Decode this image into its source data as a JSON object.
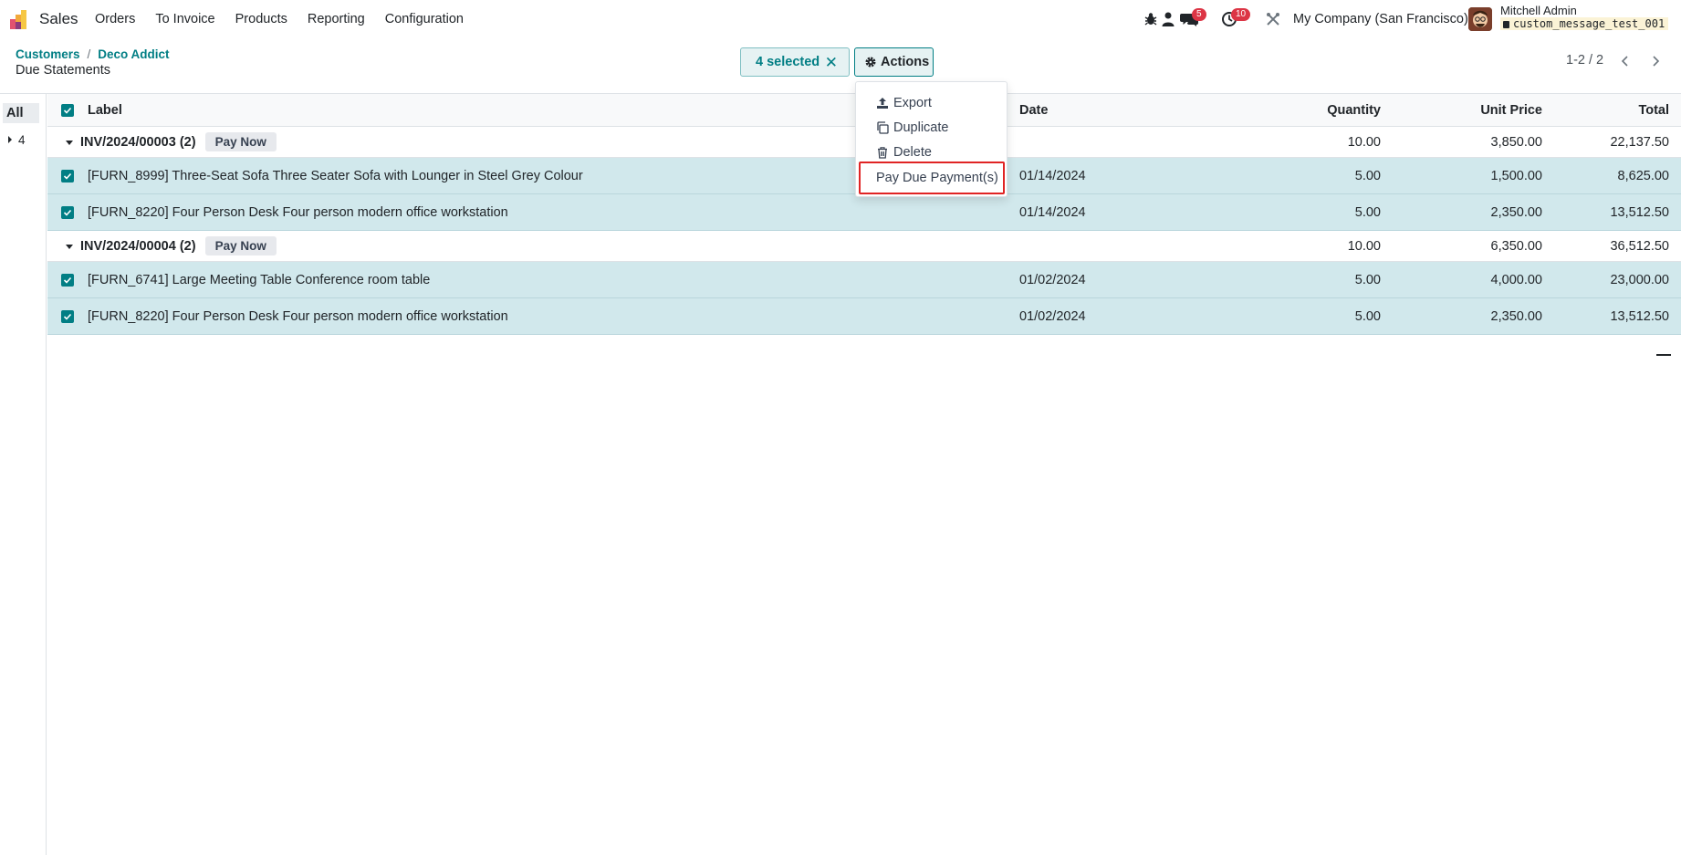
{
  "navbar": {
    "app_name": "Sales",
    "menu": [
      "Orders",
      "To Invoice",
      "Products",
      "Reporting",
      "Configuration"
    ],
    "messages_count": "5",
    "activities_count": "10",
    "company": "My Company (San Francisco)",
    "user_name": "Mitchell Admin",
    "database": "custom_message_test_001"
  },
  "control_panel": {
    "breadcrumb": [
      "Customers",
      "Deco Addict"
    ],
    "title": "Due Statements",
    "selected_label": "4 selected",
    "actions_label": "Actions",
    "pager": "1-2 / 2"
  },
  "actions_menu": {
    "items": [
      "Export",
      "Duplicate",
      "Delete"
    ],
    "highlighted_item": "Pay Due Payment(s)"
  },
  "left_panel": {
    "all_label": "All",
    "count": "4"
  },
  "table": {
    "columns": {
      "label": "Label",
      "date": "Date",
      "quantity": "Quantity",
      "unit_price": "Unit Price",
      "total": "Total"
    },
    "pay_now_label": "Pay Now",
    "groups": [
      {
        "name": "INV/2024/00003 (2)",
        "quantity": "10.00",
        "unit_price": "3,850.00",
        "total": "22,137.50",
        "rows": [
          {
            "label": "[FURN_8999] Three-Seat Sofa Three Seater Sofa with Lounger in Steel Grey Colour",
            "date": "01/14/2024",
            "quantity": "5.00",
            "unit_price": "1,500.00",
            "total": "8,625.00"
          },
          {
            "label": "[FURN_8220] Four Person Desk Four person modern office workstation",
            "date": "01/14/2024",
            "quantity": "5.00",
            "unit_price": "2,350.00",
            "total": "13,512.50"
          }
        ]
      },
      {
        "name": "INV/2024/00004 (2)",
        "quantity": "10.00",
        "unit_price": "6,350.00",
        "total": "36,512.50",
        "rows": [
          {
            "label": "[FURN_6741] Large Meeting Table Conference room table",
            "date": "01/02/2024",
            "quantity": "5.00",
            "unit_price": "4,000.00",
            "total": "23,000.00"
          },
          {
            "label": "[FURN_8220] Four Person Desk Four person modern office workstation",
            "date": "01/02/2024",
            "quantity": "5.00",
            "unit_price": "2,350.00",
            "total": "13,512.50"
          }
        ]
      }
    ]
  },
  "colors": {
    "accent": "#017e84",
    "selected_row": "#d1e8ec",
    "badge": "#dc3545",
    "highlight_border": "#e02424"
  }
}
